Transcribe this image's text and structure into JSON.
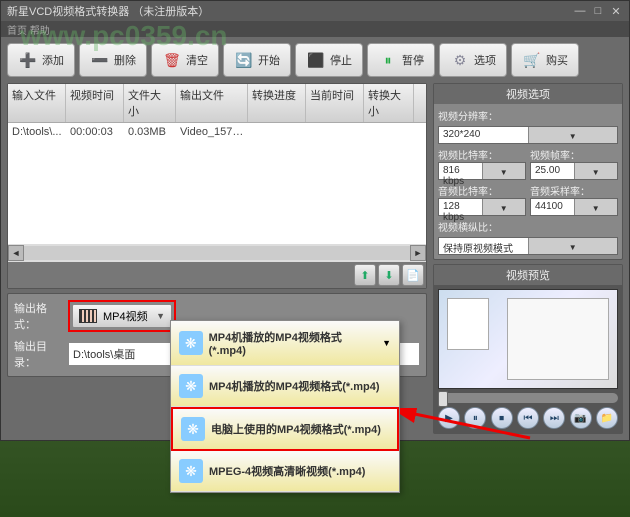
{
  "title": "新星VCD视频格式转换器  （未注册版本）",
  "subbar": "首页  帮助",
  "watermark": "www.pc0359.cn",
  "toolbar": {
    "add": "添加",
    "del": "删除",
    "clear": "清空",
    "start": "开始",
    "stop": "停止",
    "pause": "暂停",
    "options": "选项",
    "buy": "购买"
  },
  "table": {
    "headers": [
      "输入文件",
      "视频时间",
      "文件大小",
      "输出文件",
      "转换进度",
      "当前时间",
      "转换大小"
    ],
    "row": [
      "D:\\tools\\...",
      "00:00:03",
      "0.03MB",
      "Video_1578...",
      "",
      "",
      ""
    ]
  },
  "output": {
    "format_label": "输出格式：",
    "format_value": "MP4视频",
    "dir_label": "输出目录：",
    "dir_value": "D:\\tools\\桌面"
  },
  "dropdown": [
    "MP4机播放的MP4视频格式(*.mp4)",
    "MP4机播放的MP4视频格式(*.mp4)",
    "电脑上使用的MP4视频格式(*.mp4)",
    "MPEG-4视频高清晰视频(*.mp4)"
  ],
  "settings": {
    "panel_title": "视频选项",
    "res_label": "视频分辨率：",
    "res_value": "320*240",
    "vbit_label": "视频比特率：",
    "vbit_value": "816 kbps",
    "vfps_label": "视频帧率：",
    "vfps_value": "25.00",
    "abit_label": "音频比特率：",
    "abit_value": "128 kbps",
    "asamp_label": "音频采样率：",
    "asamp_value": "44100",
    "aspect_label": "视频横纵比：",
    "aspect_value": "保持原视频模式",
    "preview_title": "视频预览"
  }
}
